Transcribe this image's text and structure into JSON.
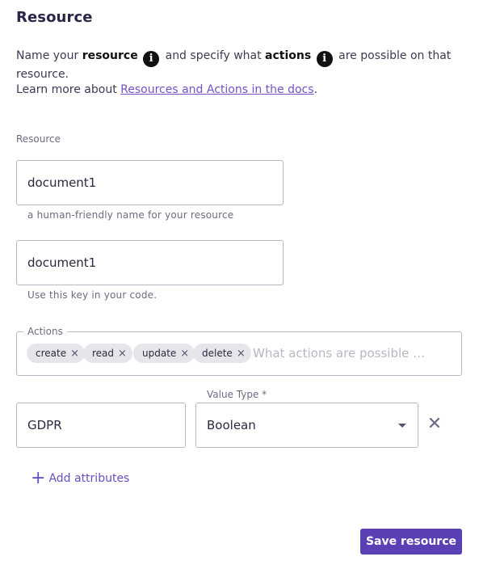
{
  "title": "Resource",
  "description": {
    "line1_prefix": "Name your",
    "resource_word": "resource",
    "middle": "and specify what",
    "actions_word": "actions",
    "suffix": "are possible on that resource.",
    "learn_prefix": "Learn more about",
    "docs_link": "Resources and Actions in the docs",
    "learn_suffix": ".",
    "info_icon_glyph": "i"
  },
  "resource_section_label": "Resource",
  "name_field": {
    "value": "document1",
    "helper": "a human-friendly name for your resource"
  },
  "key_field": {
    "value": "document1",
    "helper": "Use this key in your code."
  },
  "actions": {
    "legend": "Actions",
    "chips": [
      "create",
      "read",
      "update",
      "delete"
    ],
    "chip_remove_glyph": "×",
    "placeholder": "What actions are possible on this resource?"
  },
  "attribute": {
    "name_value": "GDPR",
    "value_type_label": "Value Type *",
    "value_type_selected": "Boolean",
    "remove_glyph": "✕"
  },
  "add_attributes": {
    "icon": "+",
    "label": "Add attributes"
  },
  "save_button": "Save resource",
  "colors": {
    "accent": "#5a3fb5",
    "link": "#7a4fc7"
  }
}
